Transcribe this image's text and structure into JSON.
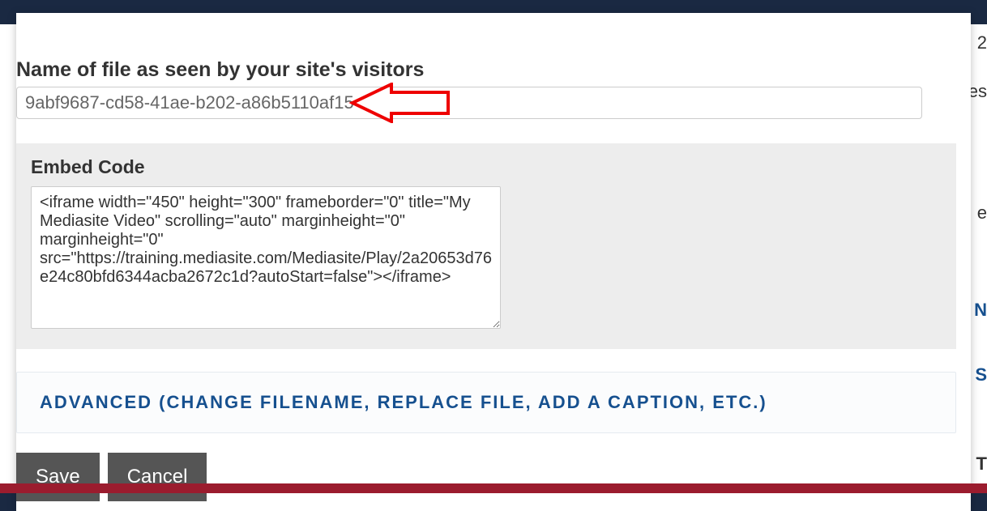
{
  "form": {
    "filename_label": "Name of file as seen by your site's visitors",
    "filename_value": "9abf9687-cd58-41ae-b202-a86b5110af15",
    "embed_label": "Embed Code",
    "embed_value": "<iframe width=\"450\" height=\"300\" frameborder=\"0\" title=\"My Mediasite Video\" scrolling=\"auto\" marginheight=\"0\" marginheight=\"0\" src=\"https://training.mediasite.com/Mediasite/Play/2a20653d76e24c80bfd6344acba2672c1d?autoStart=false\"></iframe>",
    "advanced_label": "ADVANCED (CHANGE FILENAME, REPLACE FILE, ADD A CAPTION, ETC.)",
    "save_label": "Save",
    "cancel_label": "Cancel"
  },
  "background": {
    "partial_text_1": "2",
    "partial_text_2": "es",
    "partial_text_3": "e",
    "partial_text_4": "N",
    "partial_text_5": "S",
    "partial_text_6": "T"
  },
  "annotation": {
    "arrow_color": "#ee0000"
  }
}
